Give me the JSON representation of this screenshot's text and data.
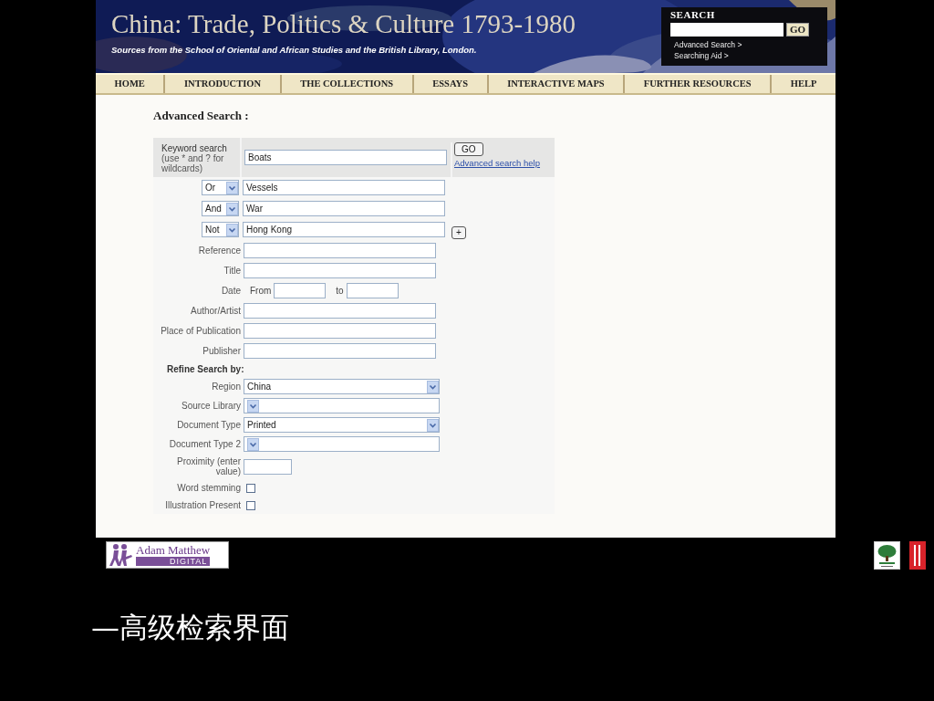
{
  "header": {
    "title": "China: Trade, Politics & Culture 1793-1980",
    "subtitle": "Sources from the School of Oriental and African Studies and the British Library, London.",
    "search": {
      "heading": "SEARCH",
      "button": "GO",
      "links": [
        "Advanced Search >",
        "Searching Aid >"
      ]
    }
  },
  "nav": [
    {
      "label": "HOME"
    },
    {
      "label": "INTRODUCTION"
    },
    {
      "label": "THE COLLECTIONS"
    },
    {
      "label": "ESSAYS"
    },
    {
      "label": "INTERACTIVE MAPS"
    },
    {
      "label": "FURTHER RESOURCES"
    },
    {
      "label": "HELP"
    }
  ],
  "page_heading": "Advanced Search :",
  "keyword": {
    "label": "Keyword search",
    "hint": "(use * and ? for wildcards)",
    "value": "Boats",
    "button": "GO",
    "help_link": "Advanced search help"
  },
  "boolean_rows": [
    {
      "operator": "Or",
      "value": "Vessels"
    },
    {
      "operator": "And",
      "value": "War"
    },
    {
      "operator": "Not",
      "value": "Hong Kong"
    }
  ],
  "add_button": "+",
  "fields": [
    {
      "kind": "text",
      "label": "Reference"
    },
    {
      "kind": "text",
      "label": "Title"
    },
    {
      "kind": "date",
      "label": "Date",
      "from_label": "From",
      "to_label": "to"
    },
    {
      "kind": "text",
      "label": "Author/Artist"
    },
    {
      "kind": "text",
      "label": "Place of Publication"
    },
    {
      "kind": "text",
      "label": "Publisher"
    }
  ],
  "refine": {
    "heading": "Refine Search by:",
    "fields": [
      {
        "kind": "select",
        "label": "Region",
        "value": "China"
      },
      {
        "kind": "select",
        "label": "Source Library"
      },
      {
        "kind": "select",
        "label": "Document Type",
        "value": "Printed"
      },
      {
        "kind": "select",
        "label": "Document Type 2"
      },
      {
        "kind": "short",
        "label": "Proximity (enter value)"
      },
      {
        "kind": "checkbox",
        "label": "Word stemming",
        "checked": false
      },
      {
        "kind": "checkbox",
        "label": "Illustration Present",
        "checked": false
      }
    ]
  },
  "footer": {
    "publisher_logo": {
      "name": "Adam Matthew",
      "tagline": "DIGITAL"
    }
  },
  "caption": "—高级检索界面"
}
